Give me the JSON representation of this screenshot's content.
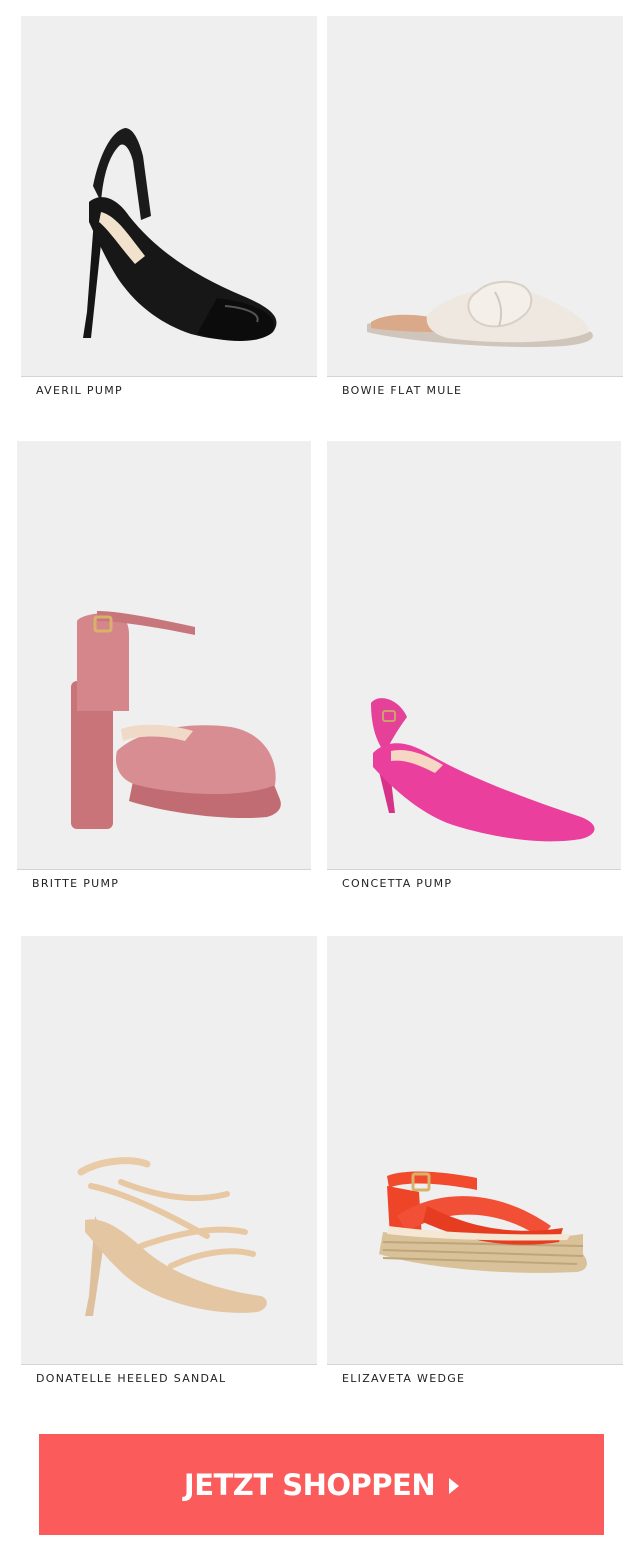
{
  "products": [
    {
      "name": "AVERIL PUMP",
      "image_icon": "black-slingback-pump-icon",
      "color": "#151515"
    },
    {
      "name": "BOWIE FLAT MULE",
      "image_icon": "cream-flat-mule-icon",
      "color": "#e9e2da"
    },
    {
      "name": "BRITTE PUMP",
      "image_icon": "pink-platform-pump-icon",
      "color": "#cf7f82"
    },
    {
      "name": "CONCETTA PUMP",
      "image_icon": "magenta-slingback-pump-icon",
      "color": "#ea3f9c"
    },
    {
      "name": "DONATELLE HEELED SANDAL",
      "image_icon": "nude-strappy-sandal-icon",
      "color": "#ecd0b0"
    },
    {
      "name": "ELIZAVETA WEDGE",
      "image_icon": "red-espadrille-wedge-icon",
      "color": "#f24a2c"
    }
  ],
  "cta": {
    "label": "JETZT SHOPPEN",
    "arrow_icon": "chevron-right-icon",
    "color": "#fb5b5a"
  }
}
